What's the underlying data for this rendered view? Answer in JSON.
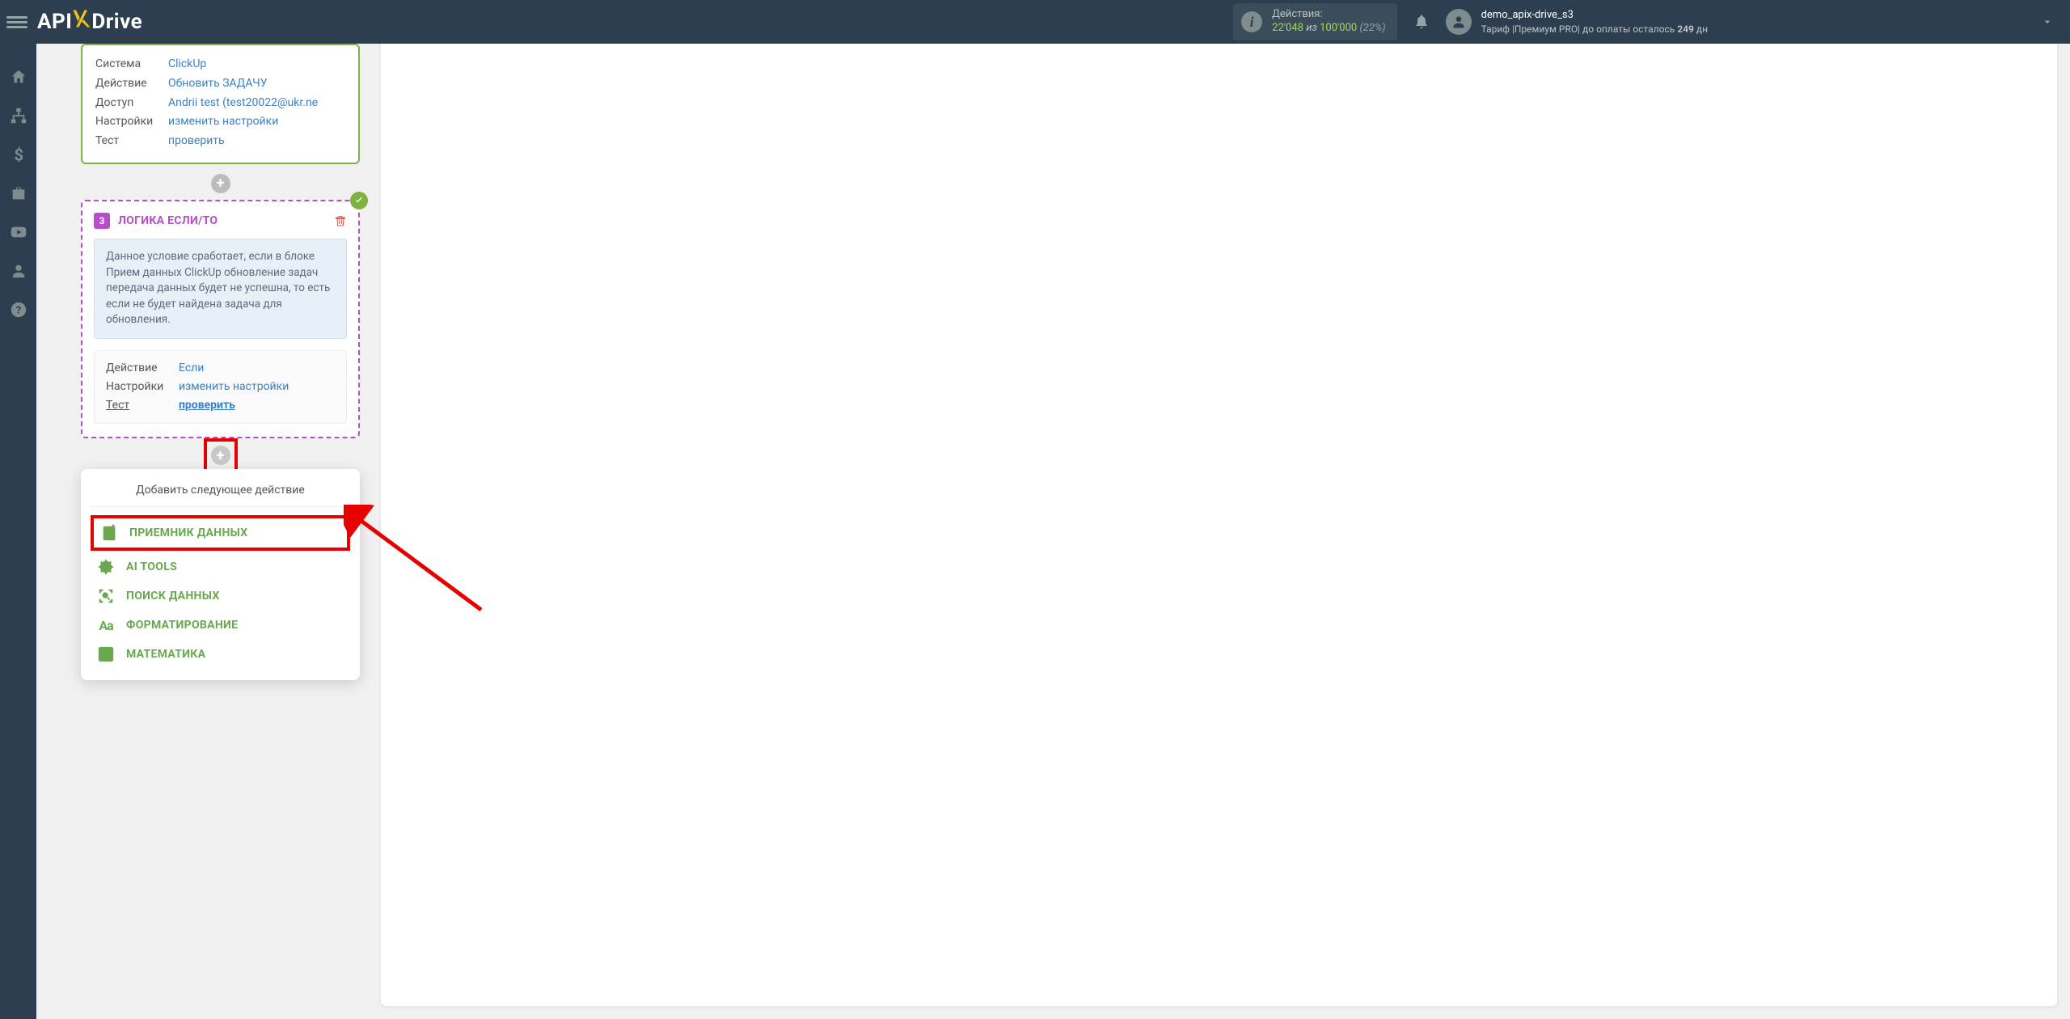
{
  "header": {
    "logo": {
      "api": "API",
      "x": "X",
      "drive": "Drive"
    },
    "actions": {
      "label": "Действия:",
      "value": "22'048",
      "iz": "из",
      "max": "100'000",
      "pct": "(22%)"
    },
    "user": {
      "name": "demo_apix-drive_s3",
      "tariff_pre": "Тариф |Премиум PRO| до оплаты осталось ",
      "days": "249",
      "days_unit": " дн"
    }
  },
  "block1": {
    "rows": {
      "system_label": "Система",
      "system_value": "ClickUp",
      "action_label": "Действие",
      "action_value": "Обновить ЗАДАЧУ",
      "access_label": "Доступ",
      "access_value": "Andrii test (test20022@ukr.ne",
      "settings_label": "Настройки",
      "settings_value": "изменить настройки",
      "test_label": "Тест",
      "test_value": "проверить"
    }
  },
  "block2": {
    "num": "3",
    "title": "ЛОГИКА ЕСЛИ/ТО",
    "info": "Данное условие сработает, если в блоке Прием данных ClickUp обновление задач передача данных будет не успешна, то есть если не будет найдена задача для обновления.",
    "rows": {
      "action_label": "Действие",
      "action_value": "Если",
      "settings_label": "Настройки",
      "settings_value": "изменить настройки",
      "test_label": "Тест",
      "test_value": "проверить"
    }
  },
  "popup": {
    "title": "Добавить следующее действие",
    "items": {
      "receiver": "ПРИЕМНИК ДАННЫХ",
      "ai": "AI TOOLS",
      "search": "ПОИСК ДАННЫХ",
      "format": "ФОРМАТИРОВАНИЕ",
      "math": "МАТЕМАТИКА"
    }
  }
}
